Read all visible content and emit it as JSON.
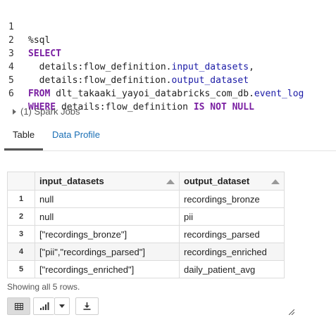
{
  "code": {
    "line_numbers": [
      "1",
      "2",
      "3",
      "4",
      "5",
      "6"
    ],
    "l1": "%sql",
    "l2_kw": "SELECT",
    "l3_a": "  details:flow_definition.",
    "l3_b": "input_datasets",
    "l3_c": ",",
    "l4_a": "  details:flow_definition.",
    "l4_b": "output_dataset",
    "l5_kw": "FROM",
    "l5_a": " dlt_takaaki_yayoi_databricks_com_db.",
    "l5_b": "event_log",
    "l6_kw": "WHERE",
    "l6_a": " details:flow_definition ",
    "l6_kw2": "IS NOT",
    "l6_kw3": " NULL"
  },
  "spark_jobs": "(1) Spark Jobs",
  "tabs": {
    "table": "Table",
    "profile": "Data Profile"
  },
  "table": {
    "headers": [
      "input_datasets",
      "output_dataset"
    ],
    "rows": [
      {
        "idx": "1",
        "input": "null",
        "output": "recordings_bronze"
      },
      {
        "idx": "2",
        "input": "null",
        "output": "pii"
      },
      {
        "idx": "3",
        "input": "[\"recordings_bronze\"]",
        "output": "recordings_parsed"
      },
      {
        "idx": "4",
        "input": "[\"pii\",\"recordings_parsed\"]",
        "output": "recordings_enriched"
      },
      {
        "idx": "5",
        "input": "[\"recordings_enriched\"]",
        "output": "daily_patient_avg"
      }
    ]
  },
  "status": "Showing all 5 rows.",
  "toolbar": {
    "icons": [
      "table-icon",
      "bar-chart-icon",
      "dropdown-caret-icon",
      "download-icon"
    ]
  },
  "colors": {
    "keyword": "#7a1fa2",
    "field": "#1a1aa6",
    "link": "#1a6fb5"
  }
}
